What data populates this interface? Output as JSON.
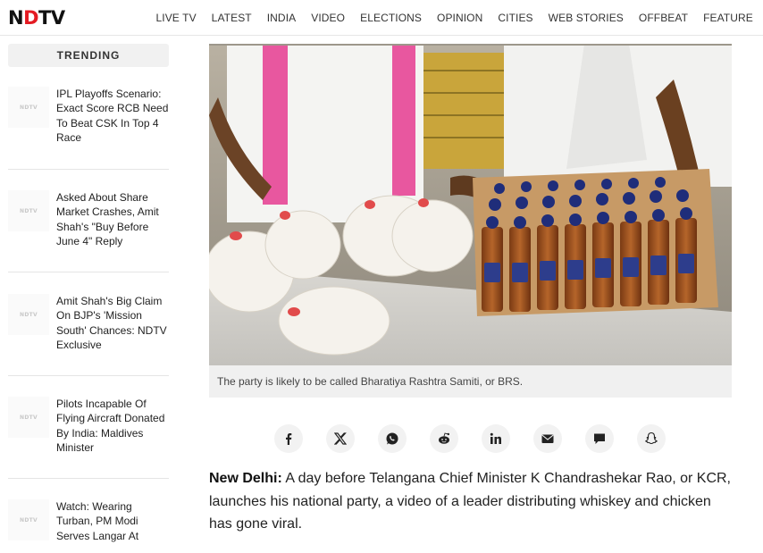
{
  "header": {
    "logo_part1": "N",
    "logo_part2": "D",
    "logo_part3": "TV",
    "nav": [
      "LIVE TV",
      "LATEST",
      "INDIA",
      "VIDEO",
      "ELECTIONS",
      "OPINION",
      "CITIES",
      "WEB STORIES",
      "OFFBEAT",
      "FEATURE"
    ]
  },
  "sidebar": {
    "heading": "TRENDING",
    "thumb_text": "NDTV",
    "items": [
      {
        "title": "IPL Playoffs Scenario: Exact Score RCB Need To Beat CSK In Top 4 Race"
      },
      {
        "title": "Asked About Share Market Crashes, Amit Shah's \"Buy Before June 4\" Reply"
      },
      {
        "title": "Amit Shah's Big Claim On BJP's 'Mission South' Chances: NDTV Exclusive"
      },
      {
        "title": "Pilots Incapable Of Flying Aircraft Donated By India: Maldives Minister"
      },
      {
        "title": "Watch: Wearing Turban, PM Modi Serves Langar At"
      }
    ]
  },
  "main": {
    "caption": "The party is likely to be called Bharatiya Rashtra Samiti, or BRS.",
    "share_icons": [
      "facebook-icon",
      "x-icon",
      "whatsapp-icon",
      "reddit-icon",
      "linkedin-icon",
      "email-icon",
      "comment-icon",
      "snapchat-icon"
    ],
    "dateline": "New Delhi:",
    "body": " A day before Telangana Chief Minister K Chandrashekar Rao, or KCR, launches his national party, a video of a leader distributing whiskey and chicken has gone viral."
  },
  "colors": {
    "brand_red": "#e41b23",
    "text": "#222222"
  }
}
